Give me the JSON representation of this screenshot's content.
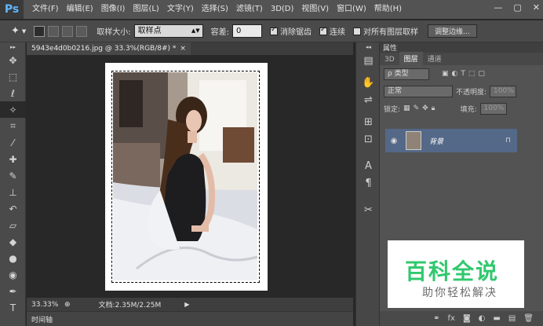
{
  "app": {
    "logo": "Ps"
  },
  "menu": [
    "文件(F)",
    "编辑(E)",
    "图像(I)",
    "图层(L)",
    "文字(Y)",
    "选择(S)",
    "滤镜(T)",
    "3D(D)",
    "视图(V)",
    "窗口(W)",
    "帮助(H)"
  ],
  "window_controls": {
    "minimize": "—",
    "restore": "▢",
    "close": "✕"
  },
  "options": {
    "sample_size_label": "取样大小:",
    "sample_size_value": "取样点",
    "tolerance_label": "容差:",
    "tolerance_value": "0",
    "antialias_label": "消除锯齿",
    "contiguous_label": "连续",
    "sample_all_label": "对所有图层取样",
    "refine_edge_label": "调整边缘..."
  },
  "document": {
    "tab_title": "5943e4d0b0216.jpg @ 33.3%(RGB/8#) *",
    "tab_close": "×",
    "zoom": "33.33%",
    "doc_info": "文档:2.35M/2.25M",
    "timeline_label": "时间轴"
  },
  "panels": {
    "properties_label": "属性",
    "tabs": [
      "3D",
      "图层",
      "通道"
    ],
    "filter_kind": "ρ 类型",
    "blend_mode": "正常",
    "opacity_label": "不透明度:",
    "opacity_value": "100%",
    "lock_label": "锁定:",
    "fill_label": "填充:",
    "fill_value": "100%",
    "layer_name": "背景"
  },
  "watermark": {
    "main": "百科全说",
    "sub": "助你轻松解决"
  },
  "colors": {
    "accent": "#5fb6ff",
    "layer_selected": "#546888",
    "watermark_green": "#31c86e"
  }
}
